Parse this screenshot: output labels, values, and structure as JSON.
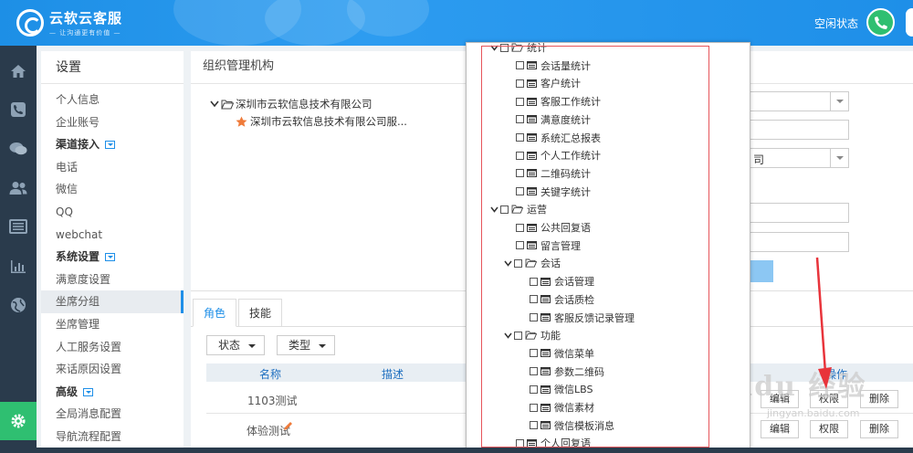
{
  "header": {
    "logo_title": "云软云客服",
    "logo_slogan": "— 让沟通更有价值 —",
    "status": "空闲状态",
    "accent": "#1e8fe8",
    "call_color": "#2fbf71"
  },
  "rail": {
    "icons": [
      "home-icon",
      "phone-icon",
      "chat-icon",
      "users-icon",
      "list-icon",
      "chart-icon",
      "globe-icon"
    ],
    "active_icon": "gear-icon"
  },
  "menu": {
    "title": "设置",
    "items": [
      {
        "label": "个人信息",
        "type": "item"
      },
      {
        "label": "企业账号",
        "type": "item"
      },
      {
        "label": "渠道接入",
        "type": "group"
      },
      {
        "label": "电话",
        "type": "item"
      },
      {
        "label": "微信",
        "type": "item"
      },
      {
        "label": "QQ",
        "type": "item"
      },
      {
        "label": "webchat",
        "type": "item"
      },
      {
        "label": "系统设置",
        "type": "group"
      },
      {
        "label": "满意度设置",
        "type": "item"
      },
      {
        "label": "坐席分组",
        "type": "active"
      },
      {
        "label": "坐席管理",
        "type": "item"
      },
      {
        "label": "人工服务设置",
        "type": "item"
      },
      {
        "label": "来话原因设置",
        "type": "item"
      },
      {
        "label": "高级",
        "type": "group"
      },
      {
        "label": "全局消息配置",
        "type": "item"
      },
      {
        "label": "导航流程配置",
        "type": "item"
      }
    ]
  },
  "org": {
    "title": "组织管理机构",
    "root": "深圳市云软信息技术有限公司",
    "child": "深圳市云软信息技术有限公司服..."
  },
  "form": {
    "partial_value": "司"
  },
  "tabs": [
    "角色",
    "技能"
  ],
  "filters": {
    "status": "状态",
    "type": "类型"
  },
  "table": {
    "headers": {
      "name": "名称",
      "desc": "描述",
      "op": "操作"
    },
    "rows": [
      {
        "name": "1103测试"
      },
      {
        "name": "体验测试"
      }
    ],
    "actions": {
      "edit": "编辑",
      "perm": "权限",
      "del": "删除"
    }
  },
  "tree": [
    {
      "label": "统计",
      "level": 0,
      "folder": true
    },
    {
      "label": "会话量统计",
      "level": 1
    },
    {
      "label": "客户统计",
      "level": 1
    },
    {
      "label": "客服工作统计",
      "level": 1
    },
    {
      "label": "满意度统计",
      "level": 1
    },
    {
      "label": "系统汇总报表",
      "level": 1
    },
    {
      "label": "个人工作统计",
      "level": 1
    },
    {
      "label": "二维码统计",
      "level": 1
    },
    {
      "label": "关键字统计",
      "level": 1
    },
    {
      "label": "运营",
      "level": 0,
      "folder": true
    },
    {
      "label": "公共回复语",
      "level": 1
    },
    {
      "label": "留言管理",
      "level": 1
    },
    {
      "label": "会话",
      "level": 1,
      "folder": true
    },
    {
      "label": "会话管理",
      "level": 2
    },
    {
      "label": "会话质检",
      "level": 2
    },
    {
      "label": "客服反馈记录管理",
      "level": 2
    },
    {
      "label": "功能",
      "level": 1,
      "folder": true
    },
    {
      "label": "微信菜单",
      "level": 2
    },
    {
      "label": "参数二维码",
      "level": 2
    },
    {
      "label": "微信LBS",
      "level": 2
    },
    {
      "label": "微信素材",
      "level": 2
    },
    {
      "label": "微信模板消息",
      "level": 2
    },
    {
      "label": "个人回复语",
      "level": 1
    }
  ],
  "watermark": {
    "main": "Baidu 经验",
    "sub": "jingyan.baidu.com"
  }
}
